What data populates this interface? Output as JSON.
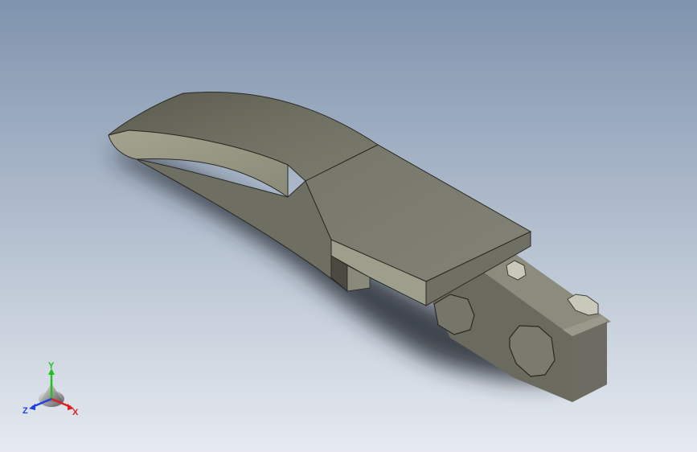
{
  "viewport": {
    "background_top": "#7f93ad",
    "background_bottom": "#e6eaf0",
    "model_color": "#7d7d70",
    "shadow_color": "#2a2e38"
  },
  "triad": {
    "x_label": "X",
    "y_label": "Y",
    "z_label": "Z",
    "x_color": "#e02020",
    "y_color": "#20c020",
    "z_color": "#2040e0"
  }
}
